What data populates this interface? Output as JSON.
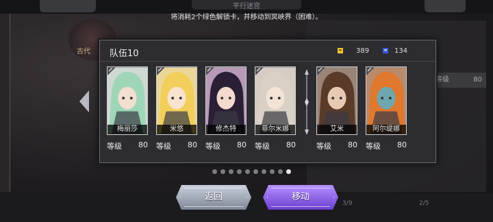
{
  "background": {
    "title": "平行迷宫",
    "emblem_label": "古代",
    "recommend_label": "推荐等级",
    "recommend_value": "80",
    "bottom_slot_1": "3/9",
    "bottom_slot_2": "2/5"
  },
  "notice": "将消耗2个绿色解锁卡，并移动到冥峡界（困难）。",
  "dialog": {
    "title": "队伍10",
    "resource_1": {
      "icon": "gold-key-icon",
      "value": "389",
      "color": "#f1c232"
    },
    "resource_2": {
      "icon": "blue-key-icon",
      "value": "134",
      "color": "#3b5bd6"
    },
    "level_label": "等级",
    "cards": [
      {
        "name": "梅丽莎",
        "level": "80",
        "hair": "#9fd6b8",
        "skin": "#f3dfd2",
        "bg": "#cfd8d2"
      },
      {
        "name": "米悠",
        "level": "80",
        "hair": "#f2cf5a",
        "skin": "#f8e3cf",
        "bg": "#e9d79a"
      },
      {
        "name": "修杰特",
        "level": "80",
        "hair": "#2a1f35",
        "skin": "#f4d9cf",
        "bg": "#b89ab8"
      },
      {
        "name": "菲尔米娜",
        "level": "80",
        "hair": "#d9d0c6",
        "skin": "#f3e2d6",
        "bg": "#d6ccc4"
      },
      {
        "name": "艾米",
        "level": "80",
        "hair": "#5a3b2a",
        "skin": "#e8c9b2",
        "bg": "#9a8478"
      },
      {
        "name": "阿尔缇娜",
        "level": "80",
        "hair": "#e0782e",
        "skin": "#6fa7b0",
        "bg": "#b98a6b"
      }
    ]
  },
  "pagination": {
    "count": 10,
    "active_index": 9
  },
  "buttons": {
    "back": "返回",
    "move": "移动"
  }
}
